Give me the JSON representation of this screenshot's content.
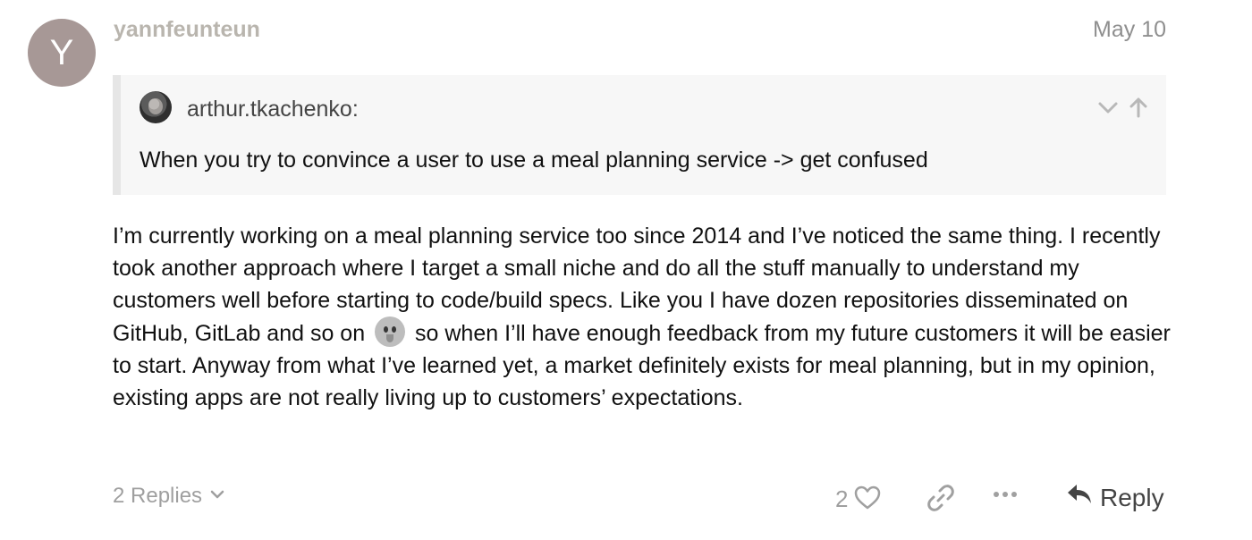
{
  "post": {
    "avatar_letter": "Y",
    "avatar_color": "#a79896",
    "username": "yannfeunteun",
    "date": "May 10"
  },
  "quote": {
    "author": "arthur.tkachenko:",
    "text": "When you try to convince a user to use a meal planning service -> get confused",
    "icons": [
      "chevron-down-icon",
      "arrow-up-icon"
    ]
  },
  "body": {
    "part1": "I’m currently working on a meal planning service too since 2014 and I’ve noticed the same thing. I recently took another approach where I target a small niche and do all the stuff manually to understand my customers well before starting to code/build specs. Like you I have dozen repositories disseminated on GitHub, GitLab and so on",
    "emoji": "stuck-out-tongue-emoji",
    "part2": "so when I’ll have enough feedback from my future customers it will be easier to start. Anyway from what I’ve learned yet, a market definitely exists for meal planning, but in my opinion, existing apps are not really living up to customers’ expectations."
  },
  "footer": {
    "replies_label": "2 Replies",
    "like_count": "2",
    "reply_label": "Reply",
    "icons": [
      "heart-icon",
      "link-icon",
      "more-icon",
      "reply-icon"
    ]
  }
}
